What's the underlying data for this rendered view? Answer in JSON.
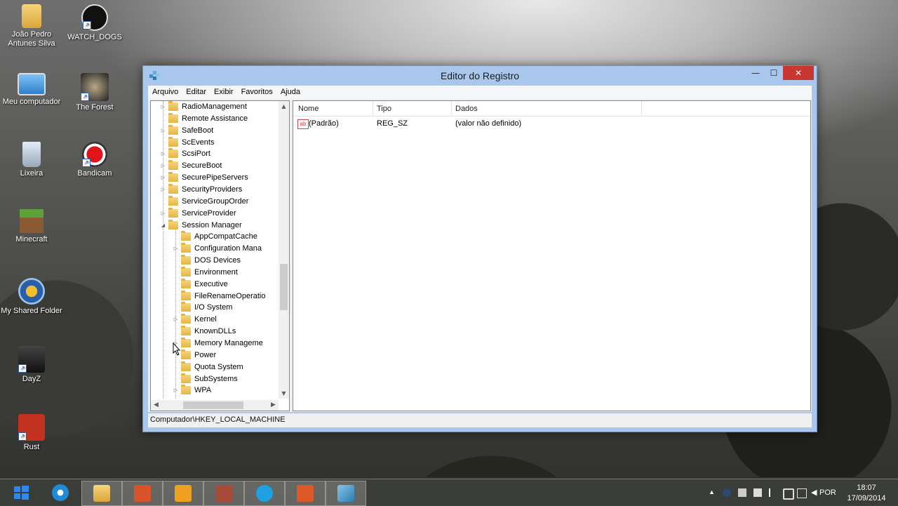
{
  "desktop": {
    "icons": [
      {
        "label": "João Pedro Antunes Silva",
        "icon": "user-folder-icon"
      },
      {
        "label": "WATCH_DOGS",
        "icon": "watch-dogs-icon"
      },
      {
        "label": "Meu computador",
        "icon": "computer-icon"
      },
      {
        "label": "The Forest",
        "icon": "the-forest-icon"
      },
      {
        "label": "Lixeira",
        "icon": "recycle-bin-icon"
      },
      {
        "label": "Bandicam",
        "icon": "bandicam-icon"
      },
      {
        "label": "Minecraft",
        "icon": "minecraft-icon"
      },
      {
        "label": "My Shared Folder",
        "icon": "shared-folder-icon"
      },
      {
        "label": "DayZ",
        "icon": "dayz-icon"
      },
      {
        "label": "Rust",
        "icon": "rust-icon"
      }
    ]
  },
  "window": {
    "title": "Editor do Registro",
    "minimize_glyph": "—",
    "maximize_glyph": "☐",
    "close_glyph": "✕",
    "menu": [
      "Arquivo",
      "Editar",
      "Exibir",
      "Favoritos",
      "Ajuda"
    ],
    "tree": {
      "items": [
        {
          "label": "RadioManagement",
          "expander": "▷"
        },
        {
          "label": "Remote Assistance",
          "expander": ""
        },
        {
          "label": "SafeBoot",
          "expander": "▷"
        },
        {
          "label": "ScEvents",
          "expander": ""
        },
        {
          "label": "ScsiPort",
          "expander": "▷"
        },
        {
          "label": "SecureBoot",
          "expander": "▷"
        },
        {
          "label": "SecurePipeServers",
          "expander": "▷"
        },
        {
          "label": "SecurityProviders",
          "expander": "▷"
        },
        {
          "label": "ServiceGroupOrder",
          "expander": ""
        },
        {
          "label": "ServiceProvider",
          "expander": "▷"
        },
        {
          "label": "Session Manager",
          "expander": "◢"
        },
        {
          "label": "AppCompatCache",
          "expander": ""
        },
        {
          "label": "Configuration Mana",
          "expander": "▷"
        },
        {
          "label": "DOS Devices",
          "expander": ""
        },
        {
          "label": "Environment",
          "expander": ""
        },
        {
          "label": "Executive",
          "expander": ""
        },
        {
          "label": "FileRenameOperatio",
          "expander": ""
        },
        {
          "label": "I/O System",
          "expander": ""
        },
        {
          "label": "Kernel",
          "expander": "▷"
        },
        {
          "label": "KnownDLLs",
          "expander": ""
        },
        {
          "label": "Memory Manageme",
          "expander": "▷"
        },
        {
          "label": "Power",
          "expander": ""
        },
        {
          "label": "Quota System",
          "expander": ""
        },
        {
          "label": "SubSystems",
          "expander": ""
        },
        {
          "label": "WPA",
          "expander": "▷"
        }
      ],
      "scroll_up": "▲",
      "scroll_down": "▼",
      "scroll_left": "◀",
      "scroll_right": "▶"
    },
    "list": {
      "columns": [
        "Nome",
        "Tipo",
        "Dados"
      ],
      "rows": [
        {
          "icon_text": "ab",
          "name": "(Padrão)",
          "type": "REG_SZ",
          "data": "(valor não definido)"
        }
      ]
    },
    "statusbar": "Computador\\HKEY_LOCAL_MACHINE"
  },
  "taskbar": {
    "apps": [
      {
        "name": "start-button",
        "color": "#2d89ef"
      },
      {
        "name": "internet-explorer-icon",
        "color": "#1f8ad6"
      },
      {
        "name": "file-explorer-icon",
        "color": "#e8c15a"
      },
      {
        "name": "photoshop-icon",
        "color": "#d9532a"
      },
      {
        "name": "media-player-icon",
        "color": "#f0a020"
      },
      {
        "name": "winrar-icon",
        "color": "#a84a3a"
      },
      {
        "name": "skype-icon",
        "color": "#1fa0e3"
      },
      {
        "name": "office-icon",
        "color": "#dd5a28"
      },
      {
        "name": "registry-editor-icon",
        "color": "#4aa0c8"
      }
    ],
    "language": "POR",
    "time": "18:07",
    "date": "17/09/2014"
  }
}
